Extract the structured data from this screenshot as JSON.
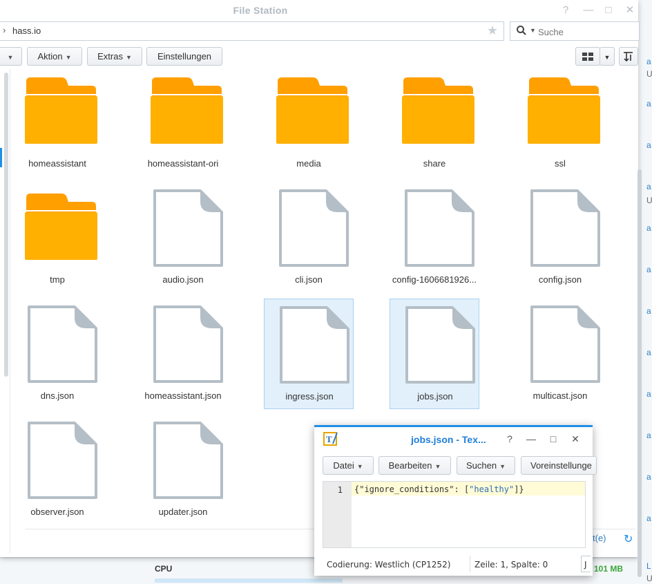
{
  "window": {
    "title": "File Station",
    "help": "?",
    "minimize": "—",
    "maximize": "□",
    "close": "✕"
  },
  "path": {
    "current": "hass.io"
  },
  "search": {
    "placeholder": "Suche"
  },
  "toolbar": {
    "aktion": "Aktion",
    "extras": "Extras",
    "einstellungen": "Einstellungen"
  },
  "files": [
    {
      "name": "homeassistant",
      "type": "folder",
      "selected": false
    },
    {
      "name": "homeassistant-ori",
      "type": "folder",
      "selected": false
    },
    {
      "name": "media",
      "type": "folder",
      "selected": false
    },
    {
      "name": "share",
      "type": "folder",
      "selected": false
    },
    {
      "name": "ssl",
      "type": "folder",
      "selected": false
    },
    {
      "name": "tmp",
      "type": "folder",
      "selected": false
    },
    {
      "name": "audio.json",
      "type": "file",
      "selected": false
    },
    {
      "name": "cli.json",
      "type": "file",
      "selected": false
    },
    {
      "name": "config-1606681926...",
      "type": "file",
      "selected": false
    },
    {
      "name": "config.json",
      "type": "file",
      "selected": false
    },
    {
      "name": "dns.json",
      "type": "file",
      "selected": false
    },
    {
      "name": "homeassistant.json",
      "type": "file",
      "selected": false
    },
    {
      "name": "ingress.json",
      "type": "file",
      "selected": true
    },
    {
      "name": "jobs.json",
      "type": "file",
      "selected": true
    },
    {
      "name": "multicast.json",
      "type": "file",
      "selected": false
    },
    {
      "name": "observer.json",
      "type": "file",
      "selected": false
    },
    {
      "name": "updater.json",
      "type": "file",
      "selected": false
    }
  ],
  "statusbar": {
    "link_partial": "t(e)"
  },
  "background": {
    "cpu_label": "CPU",
    "mem_value": "101 MB"
  },
  "editor": {
    "title": "jobs.json - Tex...",
    "menu": [
      "Datei",
      "Bearbeiten",
      "Suchen",
      "Voreinstellunge"
    ],
    "line_number": "1",
    "code_prefix": "{\"ignore_conditions\": [",
    "code_string": "\"healthy\"",
    "code_suffix": "]}",
    "encoding": "Codierung: Westlich (CP1252)",
    "position": "Zeile: 1, Spalte: 0",
    "extra": "J"
  },
  "colors": {
    "accent": "#1f8ee6",
    "folder": "#ffb000",
    "folder_tab": "#ff9f00",
    "file_outline": "#b4bec6",
    "selected_bg": "#e2f0fb"
  }
}
